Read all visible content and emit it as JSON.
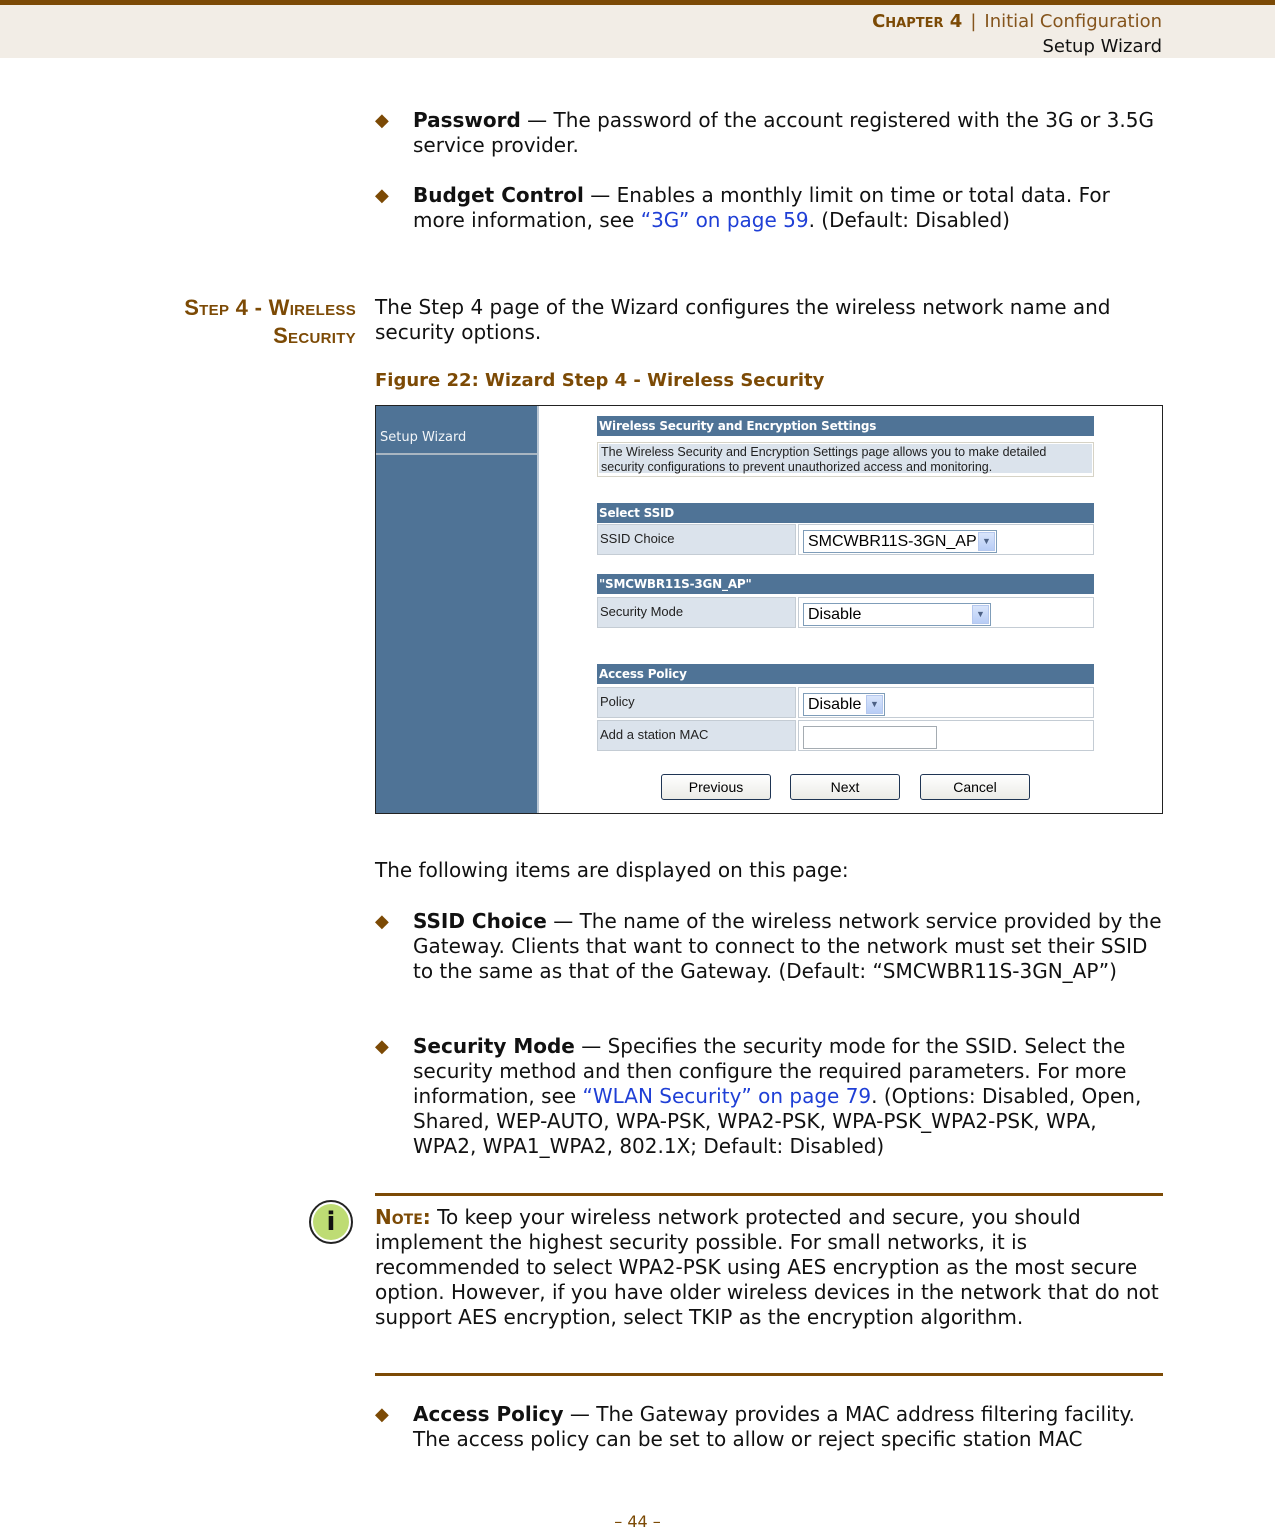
{
  "header": {
    "chapter": "Chapter 4",
    "separator": "|",
    "chapter_title": "Initial Configuration",
    "section": "Setup Wizard"
  },
  "bullets_top": [
    {
      "term": "Password",
      "dash": " — ",
      "text": "The password of the account registered with the 3G or 3.5G service provider."
    },
    {
      "term": "Budget Control",
      "dash": " — ",
      "text_before": "Enables a monthly limit on time or total data. For more information, see ",
      "link": "“3G” on page 59",
      "text_after": ". (Default: Disabled)"
    }
  ],
  "section": {
    "heading": "Step 4 - Wireless Security",
    "intro": "The Step 4 page of the Wizard configures the wireless network name and security options.",
    "figure_caption": "Figure 22:  Wizard Step 4 - Wireless Security"
  },
  "figure": {
    "sidebar_item": "Setup Wizard",
    "panel_title": "Wireless Security and Encryption Settings",
    "panel_desc": "The Wireless Security and Encryption Settings page allows you to make detailed security configurations to prevent unauthorized access and monitoring.",
    "select_ssid_title": "Select SSID",
    "ssid_choice_label": "SSID Choice",
    "ssid_choice_value": "SMCWBR11S-3GN_AP",
    "ssid_section_title": "\"SMCWBR11S-3GN_AP\"",
    "security_mode_label": "Security Mode",
    "security_mode_value": "Disable",
    "access_policy_title": "Access Policy",
    "policy_label": "Policy",
    "policy_value": "Disable",
    "mac_label": "Add a station MAC",
    "mac_value": "",
    "buttons": {
      "previous": "Previous",
      "next": "Next",
      "cancel": "Cancel"
    }
  },
  "following_intro": "The following items are displayed on this page:",
  "bullets_mid": [
    {
      "term": "SSID Choice",
      "dash": " — ",
      "text": "The name of the wireless network service provided by the Gateway. Clients that want to connect to the network must set their SSID to the same as that of the Gateway. (Default: “SMCWBR11S-3GN_AP”)"
    },
    {
      "term": "Security Mode",
      "dash": " — ",
      "text_before": "Specifies the security mode for the SSID. Select the security method and then configure the required parameters. For more information, see ",
      "link": "“WLAN Security” on page 79",
      "text_after": ". (Options: Disabled, Open, Shared, WEP-AUTO, WPA-PSK, WPA2-PSK, WPA-PSK_WPA2-PSK, WPA, WPA2, WPA1_WPA2, 802.1X; Default: Disabled)"
    }
  ],
  "note": {
    "icon": "info-icon",
    "icon_glyph": "i",
    "lead": "Note:",
    "text": " To keep your wireless network protected and secure, you should implement the highest security possible. For small networks, it is recommended to select WPA2-PSK using AES encryption as the most secure option. However, if you have older wireless devices in the network that do not support AES encryption, select TKIP as the encryption algorithm."
  },
  "bullets_bottom": [
    {
      "term": "Access Policy",
      "dash": " — ",
      "text": "The Gateway provides a MAC address filtering facility. The access policy can be set to allow or reject specific station MAC"
    }
  ],
  "bullet_glyph": "◆",
  "page_number": "–  44  –",
  "colors": {
    "accent_brown": "#7c4a05",
    "link_blue": "#1f3fd6",
    "ui_blue": "#4f7396",
    "note_icon_green": "#bedc74"
  }
}
